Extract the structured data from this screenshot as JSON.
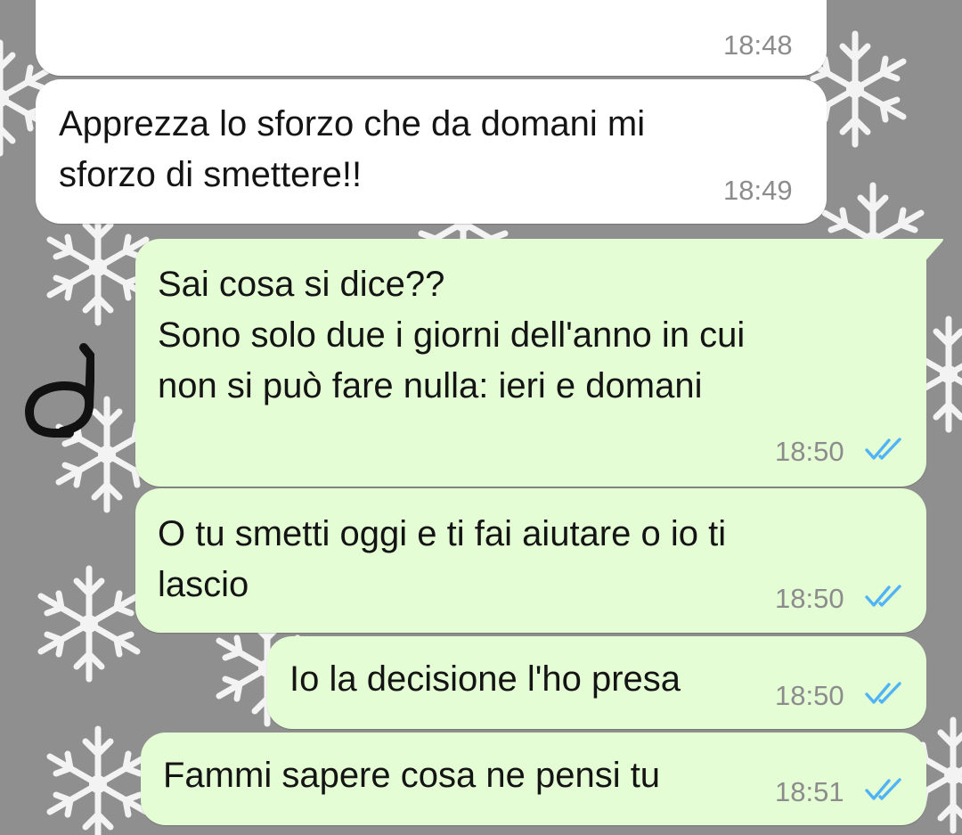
{
  "chat": {
    "background": {
      "color": "#8f8f8f",
      "pattern": "snowflake-pattern"
    },
    "bubble_colors": {
      "incoming": "#ffffff",
      "outgoing": "#e4fdd4",
      "read_ticks": "#4fb3f6"
    },
    "messages": [
      {
        "direction": "incoming",
        "text": "",
        "time": "18:48"
      },
      {
        "direction": "incoming",
        "text": "Apprezza lo sforzo che da domani mi\nsforzo di smettere!!",
        "time": "18:49"
      },
      {
        "direction": "outgoing",
        "text": "Sai cosa si dice??\nSono solo due i giorni dell'anno in cui\nnon si può fare nulla: ieri e domani",
        "time": "18:50",
        "status": "double-check-read-icon"
      },
      {
        "direction": "outgoing",
        "text": "O tu smetti oggi e ti fai aiutare o io ti\nlascio",
        "time": "18:50",
        "status": "double-check-read-icon"
      },
      {
        "direction": "outgoing",
        "text": "Io la decisione l'ho presa",
        "time": "18:50",
        "status": "double-check-read-icon"
      },
      {
        "direction": "outgoing",
        "text": "Fammi sapere cosa ne pensi tu",
        "time": "18:51",
        "status": "double-check-read-icon"
      }
    ],
    "handwritten_annotation": {
      "text": "6",
      "rotation": "rotated-90"
    }
  }
}
